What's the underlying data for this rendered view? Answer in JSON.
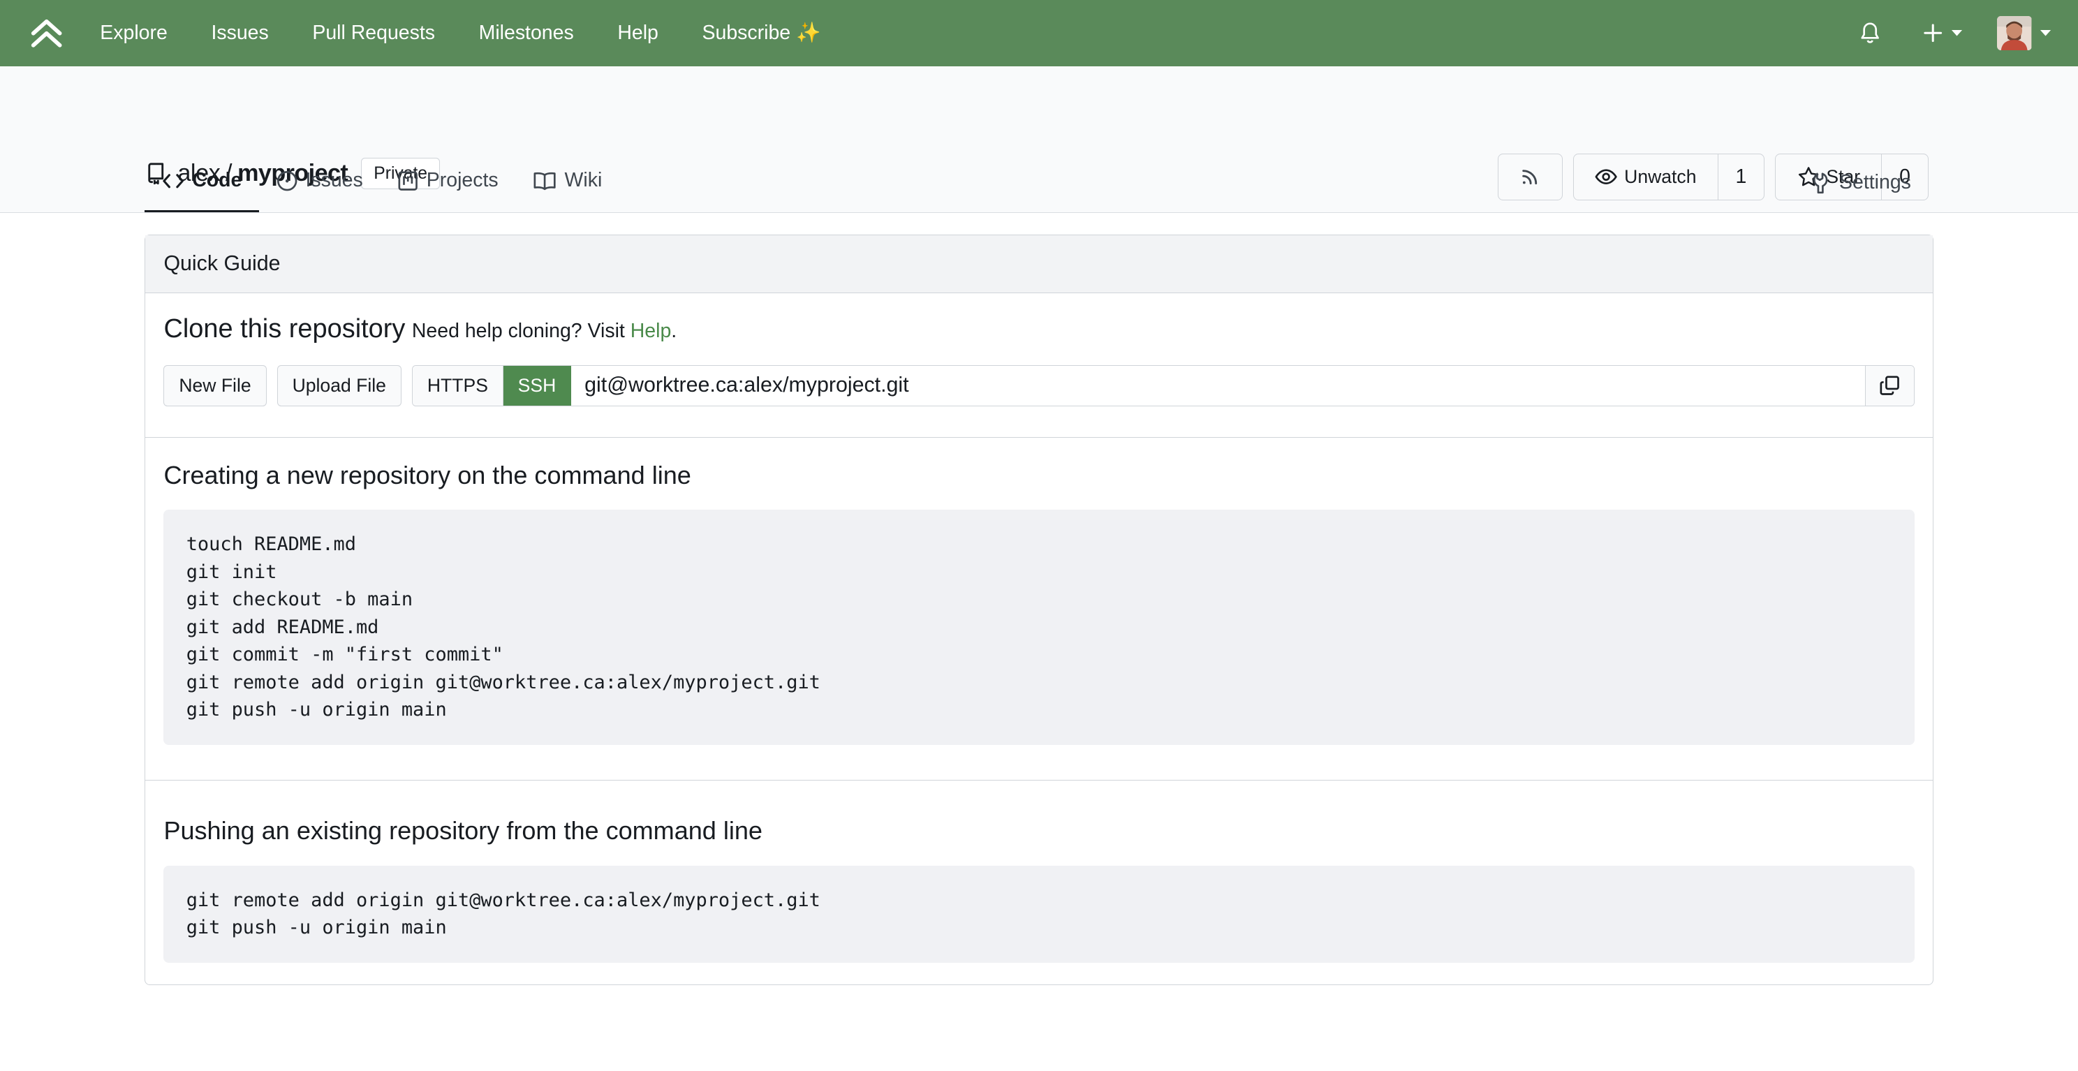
{
  "nav": {
    "items": [
      "Explore",
      "Issues",
      "Pull Requests",
      "Milestones",
      "Help",
      "Subscribe ✨"
    ]
  },
  "repo": {
    "owner": "alex",
    "separator": "/",
    "name": "myproject",
    "visibility": "Private",
    "watch_label": "Unwatch",
    "watch_count": "1",
    "star_label": "Star",
    "star_count": "0"
  },
  "tabs": {
    "code": "Code",
    "issues": "Issues",
    "projects": "Projects",
    "wiki": "Wiki",
    "settings": "Settings"
  },
  "guide": {
    "header": "Quick Guide",
    "clone_title": "Clone this repository",
    "clone_help_prefix": "Need help cloning? Visit",
    "clone_help_link": "Help",
    "clone_help_suffix": ".",
    "new_file": "New File",
    "upload_file": "Upload File",
    "https": "HTTPS",
    "ssh": "SSH",
    "clone_url": "git@worktree.ca:alex/myproject.git",
    "new_repo_title": "Creating a new repository on the command line",
    "new_repo_code": "touch README.md\ngit init\ngit checkout -b main\ngit add README.md\ngit commit -m \"first commit\"\ngit remote add origin git@worktree.ca:alex/myproject.git\ngit push -u origin main",
    "push_title": "Pushing an existing repository from the command line",
    "push_code": "git remote add origin git@worktree.ca:alex/myproject.git\ngit push -u origin main"
  },
  "colors": {
    "nav_bg": "#5a8a5a",
    "accent": "#4f8a4f",
    "link": "#4a8a4a"
  },
  "icons": {
    "logo": "gitea-chevron-logo-icon",
    "bell": "bell-icon",
    "plus": "plus-icon",
    "rss": "rss-icon",
    "watch": "eye-icon",
    "star": "star-icon",
    "code": "code-icon",
    "issues": "issue-opened-icon",
    "projects": "project-icon",
    "wiki": "book-icon",
    "settings": "tool-icon",
    "copy": "copy-icon"
  }
}
